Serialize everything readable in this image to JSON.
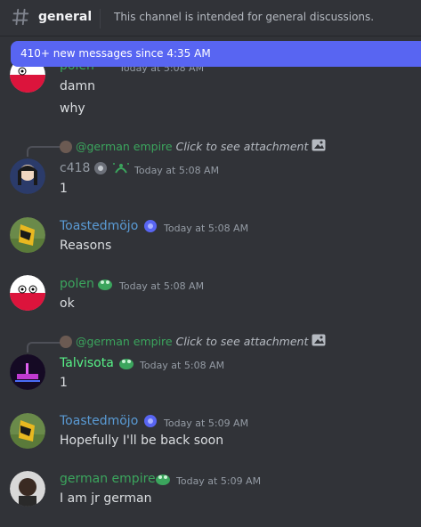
{
  "header": {
    "channel_name": "general",
    "topic": "This channel is intended for general discussions."
  },
  "banner": {
    "text": "410+ new messages since 4:35 AM"
  },
  "messages": [
    {
      "author": "polen",
      "author_color": "#3ba55d",
      "timestamp": "Today at 5:08 AM",
      "lines": [
        "damn",
        "why"
      ]
    },
    {
      "reply": {
        "mention": "@german empire",
        "text": "Click to see attachment"
      },
      "author": "c418",
      "author_color": "#949ba4",
      "timestamp": "Today at 5:08 AM",
      "lines": [
        "1"
      ]
    },
    {
      "author": "Toastedmöjo",
      "author_color": "#5a9bd5",
      "timestamp": "Today at 5:08 AM",
      "lines": [
        "Reasons"
      ]
    },
    {
      "author": "polen",
      "author_color": "#3ba55d",
      "timestamp": "Today at 5:08 AM",
      "lines": [
        "ok"
      ]
    },
    {
      "reply": {
        "mention": "@german empire",
        "text": "Click to see attachment"
      },
      "author": "Talvisota",
      "author_color": "#57f287",
      "timestamp": "Today at 5:08 AM",
      "lines": [
        "1"
      ]
    },
    {
      "author": "Toastedmöjo",
      "author_color": "#5a9bd5",
      "timestamp": "Today at 5:09 AM",
      "lines": [
        "Hopefully I'll be back soon"
      ]
    },
    {
      "author": "german empire",
      "author_color": "#3ba55d",
      "timestamp": "Today at 5:09 AM",
      "lines": [
        "I am jr german"
      ]
    }
  ]
}
